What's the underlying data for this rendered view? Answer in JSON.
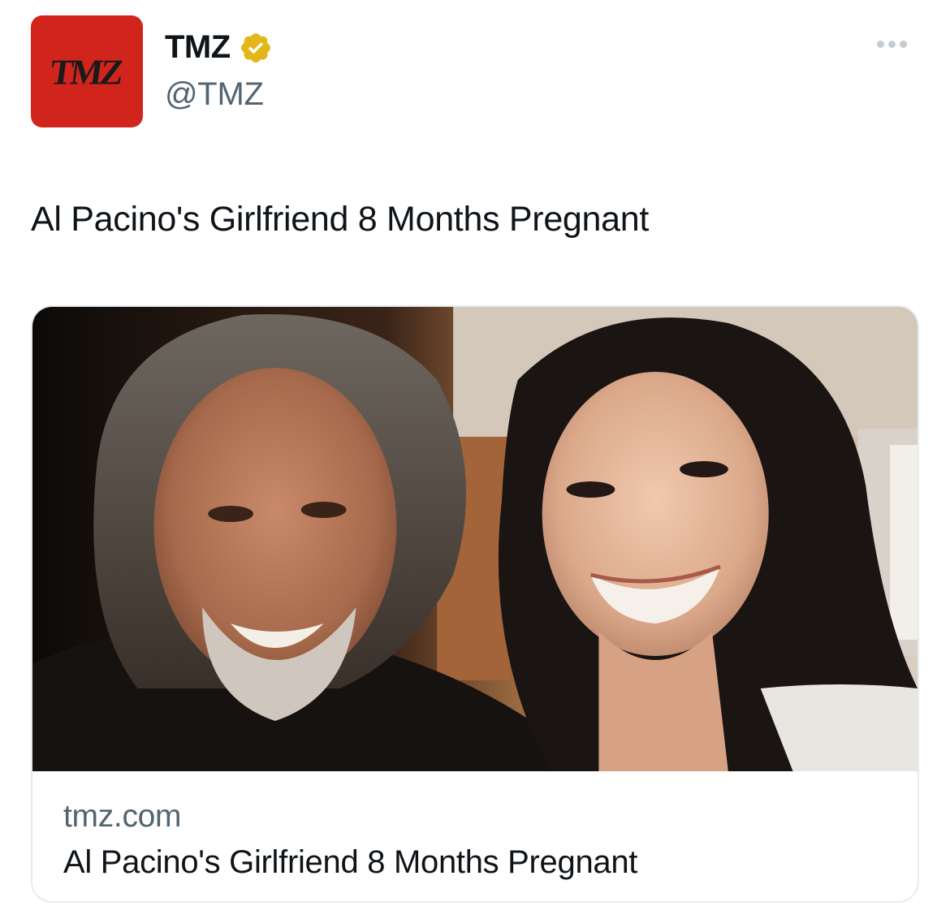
{
  "account": {
    "avatar_text": "TMZ",
    "display_name": "TMZ",
    "handle": "@TMZ",
    "verified": true,
    "verified_icon": "verified-badge-icon",
    "verified_color": "#e2b719"
  },
  "tweet": {
    "text": "Al Pacino's Girlfriend 8 Months Pregnant"
  },
  "card": {
    "domain": "tmz.com",
    "title": "Al Pacino's Girlfriend 8 Months Pregnant"
  },
  "colors": {
    "brand_red": "#d1241c",
    "secondary_text": "#536471",
    "primary_text": "#0f1419"
  }
}
